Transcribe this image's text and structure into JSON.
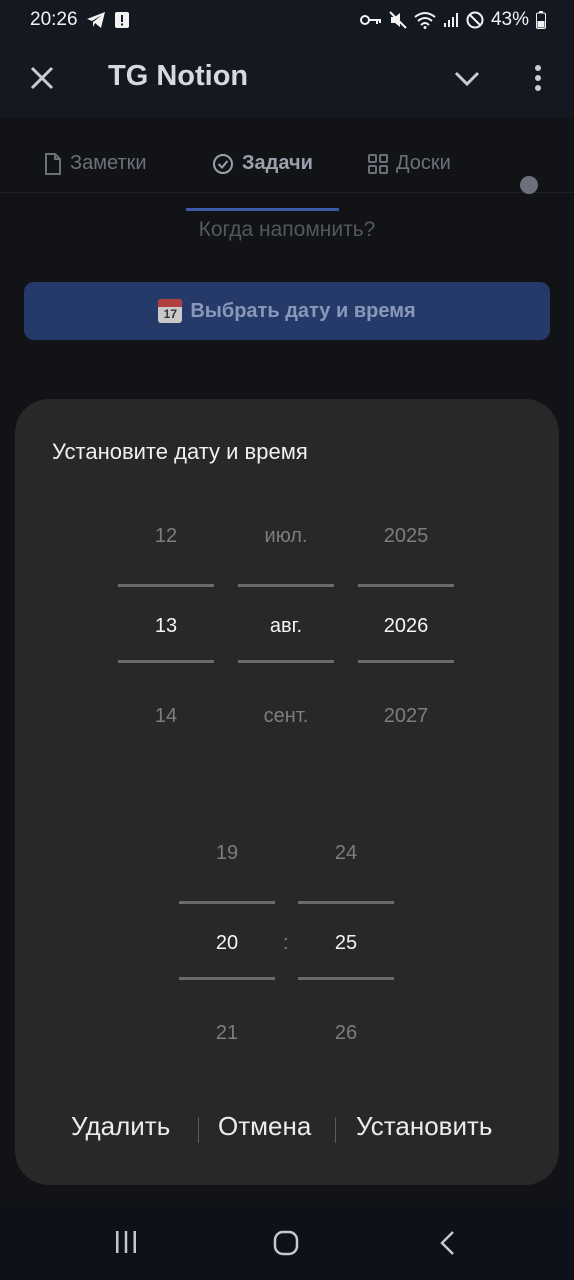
{
  "status": {
    "time": "20:26",
    "battery": "43%"
  },
  "app": {
    "title": "TG Notion"
  },
  "tabs": [
    {
      "label": "Заметки"
    },
    {
      "label": "Задачи"
    },
    {
      "label": "Доски"
    }
  ],
  "reminder": {
    "question": "Когда напомнить?",
    "button_label": "Выбрать дату и время",
    "calendar_emoji_day": "17"
  },
  "dialog": {
    "title": "Установите дату и время",
    "day": {
      "prev": "12",
      "selected": "13",
      "next": "14"
    },
    "month": {
      "prev": "июл.",
      "selected": "авг.",
      "next": "сент."
    },
    "year": {
      "prev": "2025",
      "selected": "2026",
      "next": "2027"
    },
    "hour": {
      "prev": "19",
      "selected": "20",
      "next": "21"
    },
    "minute": {
      "prev": "24",
      "selected": "25",
      "next": "26"
    },
    "time_separator": ":",
    "actions": {
      "delete": "Удалить",
      "cancel": "Отмена",
      "set": "Установить"
    }
  },
  "colors": {
    "accent": "#3a5aa8",
    "dialog_bg": "#282829",
    "button_bg": "#263a6a"
  }
}
